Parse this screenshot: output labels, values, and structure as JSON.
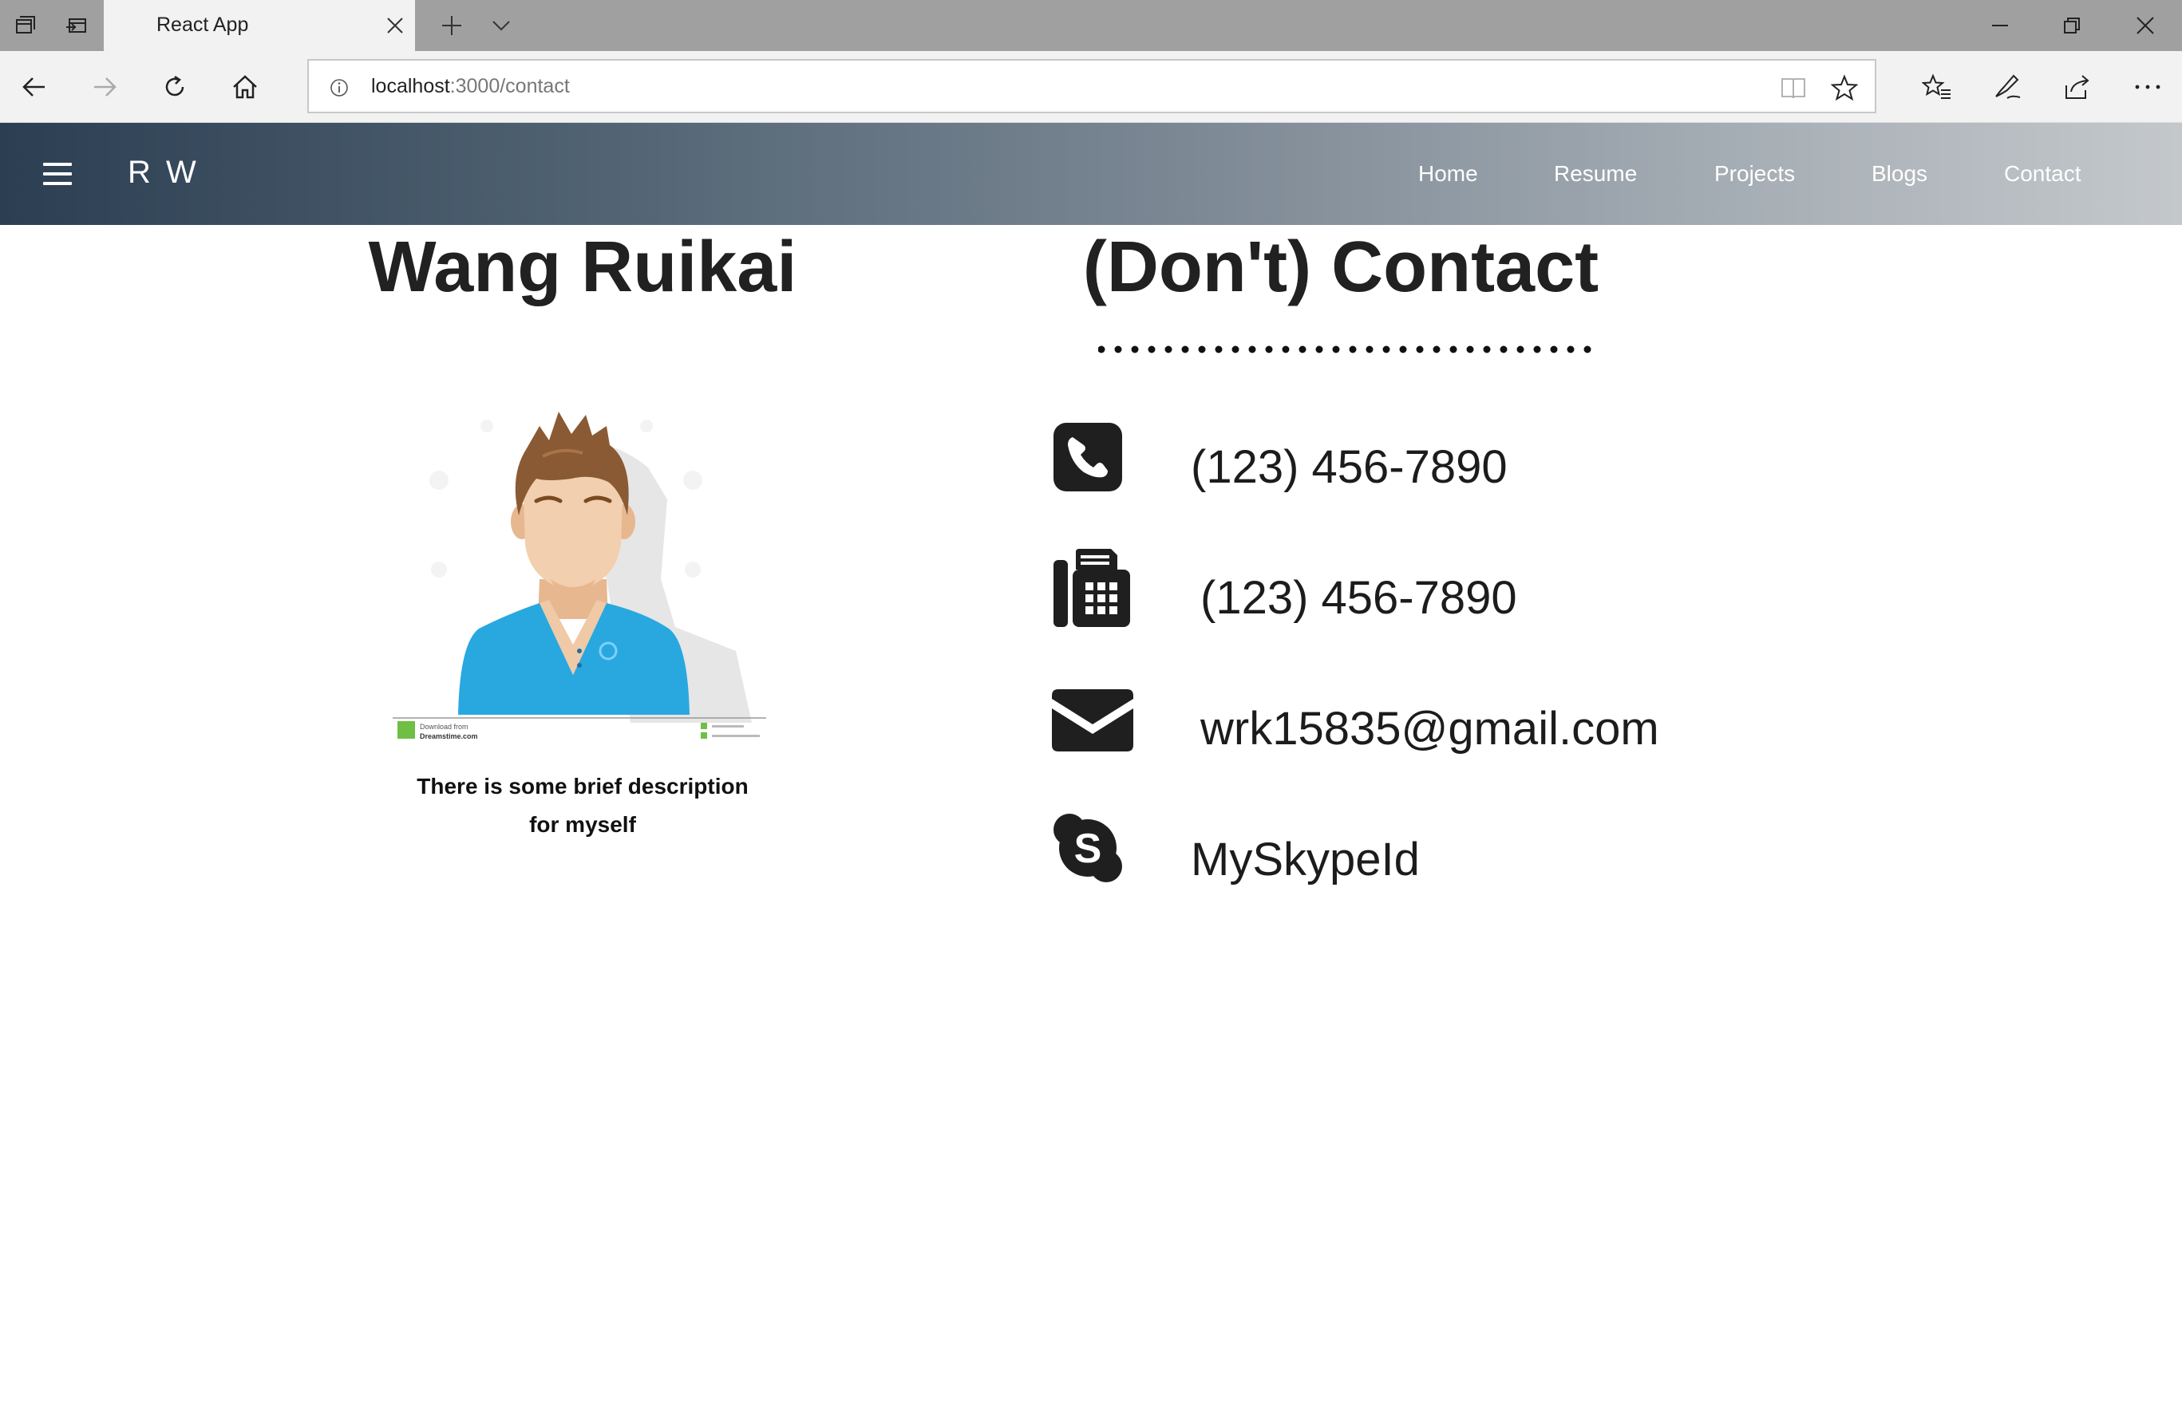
{
  "browser": {
    "tab_title": "React App",
    "url_host": "localhost",
    "url_path": ":3000/contact"
  },
  "site": {
    "brand": "R W",
    "nav": [
      "Home",
      "Resume",
      "Projects",
      "Blogs",
      "Contact"
    ]
  },
  "profile": {
    "name": "Wang Ruikai",
    "description_line1": "There is some brief description",
    "description_line2": "for myself",
    "image_watermark_line1": "Download from",
    "image_watermark_line2": "Dreamstime.com"
  },
  "contact": {
    "title": "(Don't) Contact",
    "items": [
      {
        "icon": "phone-icon",
        "value": "(123) 456-7890"
      },
      {
        "icon": "fax-icon",
        "value": "(123) 456-7890"
      },
      {
        "icon": "envelope-icon",
        "value": "wrk15835@gmail.com"
      },
      {
        "icon": "skype-icon",
        "value": "MySkypeId"
      }
    ]
  },
  "colors": {
    "nav_gradient_start": "#2c3e52",
    "nav_gradient_end": "#c4c8cb",
    "shirt": "#29a8e0",
    "hair": "#8a5a34"
  }
}
